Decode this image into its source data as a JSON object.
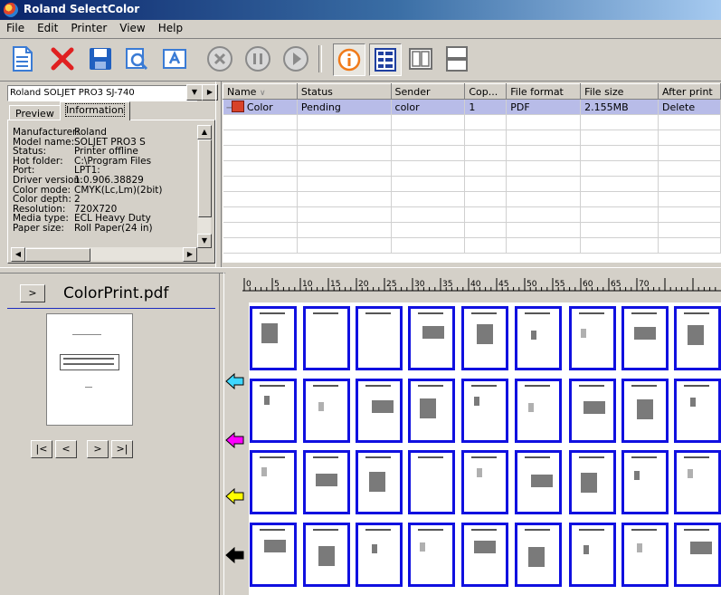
{
  "window": {
    "title": "Roland SelectColor"
  },
  "menu": [
    "File",
    "Edit",
    "Printer",
    "View",
    "Help"
  ],
  "toolbar": {
    "buttons": [
      {
        "name": "new-icon",
        "color": "#3a7bd5"
      },
      {
        "name": "delete-icon",
        "color": "#e02020"
      },
      {
        "name": "save-icon",
        "color": "#2060c0"
      },
      {
        "name": "search-icon",
        "color": "#3a7bd5"
      },
      {
        "name": "image-icon",
        "color": "#3a7bd5"
      },
      {
        "name": "cancel-icon",
        "color": "#8a8a8a"
      },
      {
        "name": "pause-icon",
        "color": "#8a8a8a"
      },
      {
        "name": "play-icon",
        "color": "#8a8a8a"
      },
      {
        "name": "info-icon",
        "color": "#f07a1a"
      },
      {
        "name": "list-view-icon",
        "color": "#2040a0"
      },
      {
        "name": "panel-view-icon",
        "color": "#707070"
      },
      {
        "name": "split-view-icon",
        "color": "#707070"
      }
    ]
  },
  "printer": {
    "selected": "Roland SOLJET PRO3 SJ-740"
  },
  "tabs": {
    "preview": "Preview",
    "information": "Information"
  },
  "info": [
    {
      "key": "Manufacturer:",
      "value": "Roland"
    },
    {
      "key": "Model name:",
      "value": "SOLJET PRO3 S"
    },
    {
      "key": "Status:",
      "value": "Printer offline"
    },
    {
      "key": "Hot folder:",
      "value": "C:\\Program Files"
    },
    {
      "key": "Port:",
      "value": "LPT1:"
    },
    {
      "key": "Driver version:",
      "value": "1.0.906.38829"
    },
    {
      "key": "Color mode:",
      "value": "CMYK(Lc,Lm)(2bit)"
    },
    {
      "key": "Color depth:",
      "value": "2"
    },
    {
      "key": "Resolution:",
      "value": "720X720"
    },
    {
      "key": "Media type:",
      "value": "ECL Heavy Duty"
    },
    {
      "key": "Paper size:",
      "value": "Roll Paper(24 in)"
    }
  ],
  "queue": {
    "columns": [
      "Name",
      "Status",
      "Sender",
      "Cop...",
      "File format",
      "File size",
      "After print"
    ],
    "rows": [
      {
        "name": "Color",
        "status": "Pending",
        "sender": "color",
        "copies": "1",
        "format": "PDF",
        "size": "2.155MB",
        "after": "Delete"
      }
    ],
    "selection_color": "#b8bce8"
  },
  "preview": {
    "filename": "ColorPrint.pdf",
    "expand_label": ">",
    "nav": [
      "|<",
      "<",
      ">",
      ">|"
    ]
  },
  "ruler": {
    "labels": [
      "0",
      "5",
      "10",
      "15",
      "20",
      "25",
      "30",
      "35",
      "40",
      "45",
      "50",
      "55",
      "60",
      "65",
      "70"
    ]
  },
  "layout": {
    "page_border_color": "#1010e0",
    "rows": 4,
    "columns": 9,
    "row_markers": [
      {
        "name": "cyan-arrow-icon",
        "color": "#3fd7ff"
      },
      {
        "name": "magenta-arrow-icon",
        "color": "#ff00ff"
      },
      {
        "name": "yellow-arrow-icon",
        "color": "#ffff00"
      },
      {
        "name": "black-arrow-icon",
        "color": "#000000"
      }
    ]
  }
}
